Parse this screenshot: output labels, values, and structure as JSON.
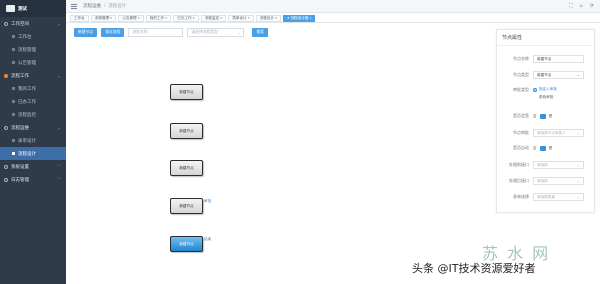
{
  "app": {
    "logo_text": "测试"
  },
  "sidebar": {
    "items": [
      {
        "type": "group",
        "label": "工作空间",
        "icon": "workspace-icon",
        "expanded": true
      },
      {
        "type": "item",
        "label": "工作台"
      },
      {
        "type": "item",
        "label": "流程管理"
      },
      {
        "type": "item",
        "label": "公告管理"
      },
      {
        "type": "group",
        "label": "流程工作",
        "icon": "workflow-icon",
        "expanded": true
      },
      {
        "type": "item",
        "label": "我的工作"
      },
      {
        "type": "item",
        "label": "已办工作"
      },
      {
        "type": "item",
        "label": "流程监控"
      },
      {
        "type": "group",
        "label": "流程运维",
        "icon": "ops-icon",
        "expanded": true
      },
      {
        "type": "item",
        "label": "表单设计"
      },
      {
        "type": "item",
        "label": "流程设计",
        "active": true
      },
      {
        "type": "group",
        "label": "系统设置",
        "icon": "settings-icon",
        "expanded": false
      },
      {
        "type": "group",
        "label": "日志管理",
        "icon": "log-icon",
        "expanded": false
      }
    ]
  },
  "topbar": {
    "breadcrumb": [
      "流程运维",
      "流程设计"
    ],
    "icons": [
      "fullscreen-icon",
      "user-icon",
      "refresh-icon"
    ]
  },
  "tabs": [
    {
      "label": "工作台",
      "active": false
    },
    {
      "label": "流程管理",
      "active": false
    },
    {
      "label": "公告管理",
      "active": false
    },
    {
      "label": "我的工作",
      "active": false
    },
    {
      "label": "已办工作",
      "active": false
    },
    {
      "label": "流程监控",
      "active": false
    },
    {
      "label": "表单设计",
      "active": false
    },
    {
      "label": "流程设计",
      "active": false
    },
    {
      "label": "流程设计器",
      "active": true
    }
  ],
  "toolbar": {
    "add_node_label": "新建节点",
    "save_flow_label": "保存流程",
    "name_placeholder": "流程名称",
    "type_placeholder": "请选择流程类型",
    "search_label": "搜索"
  },
  "canvas": {
    "nodes": [
      {
        "label": "新建节点",
        "selected": false,
        "tag": ""
      },
      {
        "label": "新建节点",
        "selected": false,
        "tag": ""
      },
      {
        "label": "新建节点",
        "selected": false,
        "tag": ""
      },
      {
        "label": "新建节点",
        "selected": false,
        "tag": "审批"
      },
      {
        "label": "新建节点",
        "selected": true,
        "tag": "结束"
      }
    ]
  },
  "panel": {
    "title": "节点属性",
    "fields": {
      "node_name_label": "节点名称",
      "node_name_value": "新建节点",
      "node_type_label": "节点类型",
      "node_type_value": "新建节点",
      "approve_type_label": "审批类型",
      "approve_opt1": "指定人审批",
      "approve_opt2": "角色审批",
      "countersign_label": "是否会签",
      "countersign_no": "否",
      "countersign_yes": "是",
      "handler_label": "节点审批",
      "handler_placeholder": "请选择节点审批人",
      "autoflow_label": "是否自动",
      "autoflow_no": "否",
      "autoflow_yes": "是",
      "prev_label": "处理前接口",
      "prev_placeholder": "请选择",
      "next_label": "处理后接口",
      "next_placeholder": "请选择",
      "form_label": "表单选择",
      "form_placeholder": "请选择表单"
    }
  },
  "watermark": {
    "logo": "苏 水 网",
    "text": "头条 @IT技术资源爱好者"
  }
}
